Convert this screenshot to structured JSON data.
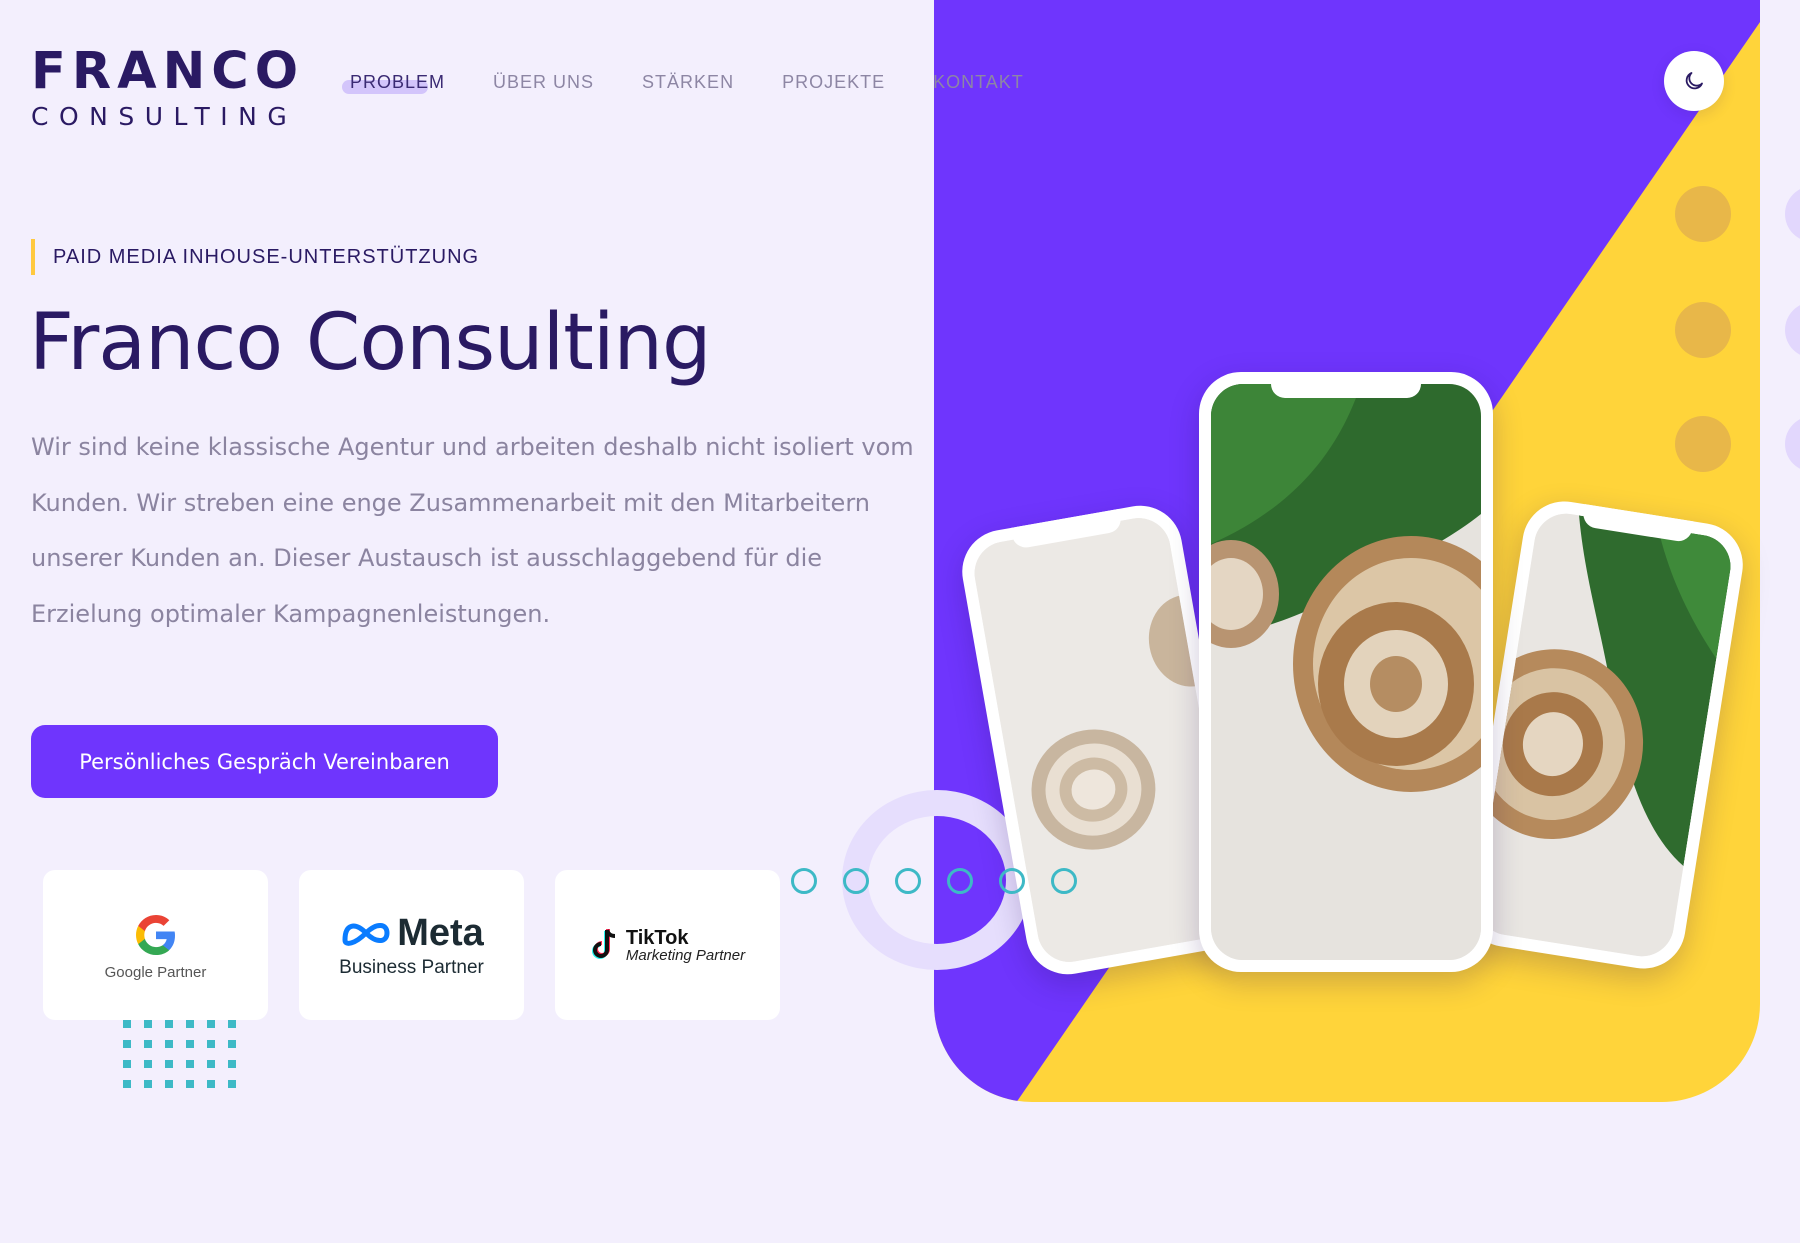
{
  "header": {
    "logo": {
      "main": "FRANCO",
      "sub": "CONSULTING"
    },
    "nav": [
      {
        "label": "PROBLEM"
      },
      {
        "label": "ÜBER UNS"
      },
      {
        "label": "STÄRKEN"
      },
      {
        "label": "PROJEKTE"
      },
      {
        "label": "KONTAKT"
      }
    ],
    "active_nav": "PROBLEM",
    "theme_toggle_icon": "moon-icon"
  },
  "hero": {
    "eyebrow": "PAID MEDIA INHOUSE-UNTERSTÜTZUNG",
    "title": "Franco Consulting",
    "description": "Wir sind keine klassische Agentur und arbeiten deshalb nicht isoliert vom Kunden. Wir streben eine enge Zusammenarbeit mit den Mitarbeitern unserer Kunden an. Dieser Austausch ist ausschlaggebend für die Erzielung optimaler Kampagnenleistungen.",
    "cta_label": "Persönliches Gespräch Vereinbaren"
  },
  "partners": {
    "google": {
      "logo_letter": "G",
      "label": "Google Partner"
    },
    "meta": {
      "word": "Meta",
      "label": "Business Partner"
    },
    "tiktok": {
      "word": "TikTok",
      "label": "Marketing Partner"
    }
  },
  "colors": {
    "background": "#f3effd",
    "primary": "#6f35fd",
    "accent_yellow": "#ffd43a",
    "text_dark": "#2a1a63",
    "text_muted": "#8b84a0",
    "teal": "#3db9c6"
  },
  "slider": {
    "dot_count": 6
  }
}
